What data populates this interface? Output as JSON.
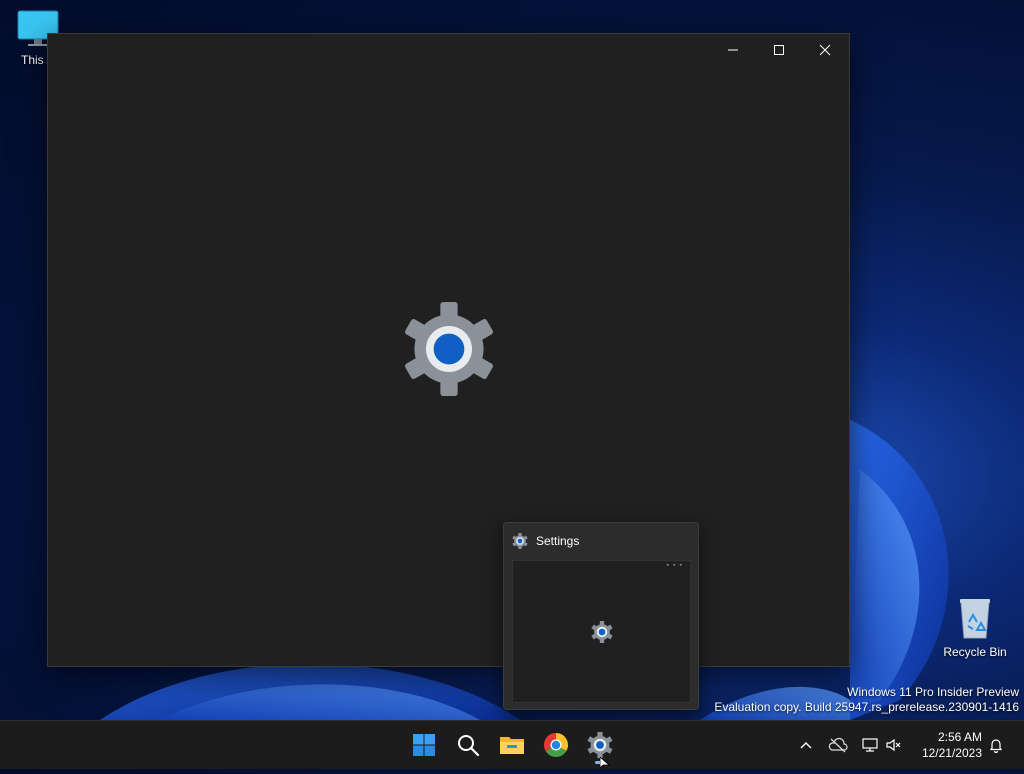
{
  "desktop": {
    "icons": [
      {
        "label": "This P"
      },
      {
        "label": "Recycle Bin"
      }
    ]
  },
  "window": {
    "title": "Settings",
    "controls": {
      "minimize": "—",
      "maximize": "☐",
      "close": "✕"
    }
  },
  "watermark": {
    "line1": "Windows 11 Pro Insider Preview",
    "line2": "Evaluation copy. Build 25947.rs_prerelease.230901-1416"
  },
  "thumbnail": {
    "title": "Settings"
  },
  "taskbar": {
    "apps": [
      "windows-start-icon",
      "search-icon",
      "file-explorer-icon",
      "chrome-icon",
      "settings-gear-icon"
    ],
    "clock": {
      "time": "2:56 AM",
      "date": "12/21/2023"
    }
  },
  "colors": {
    "accent": "#0f5fc4",
    "taskbar": "#1c1c1c",
    "window_bg": "#202020"
  }
}
